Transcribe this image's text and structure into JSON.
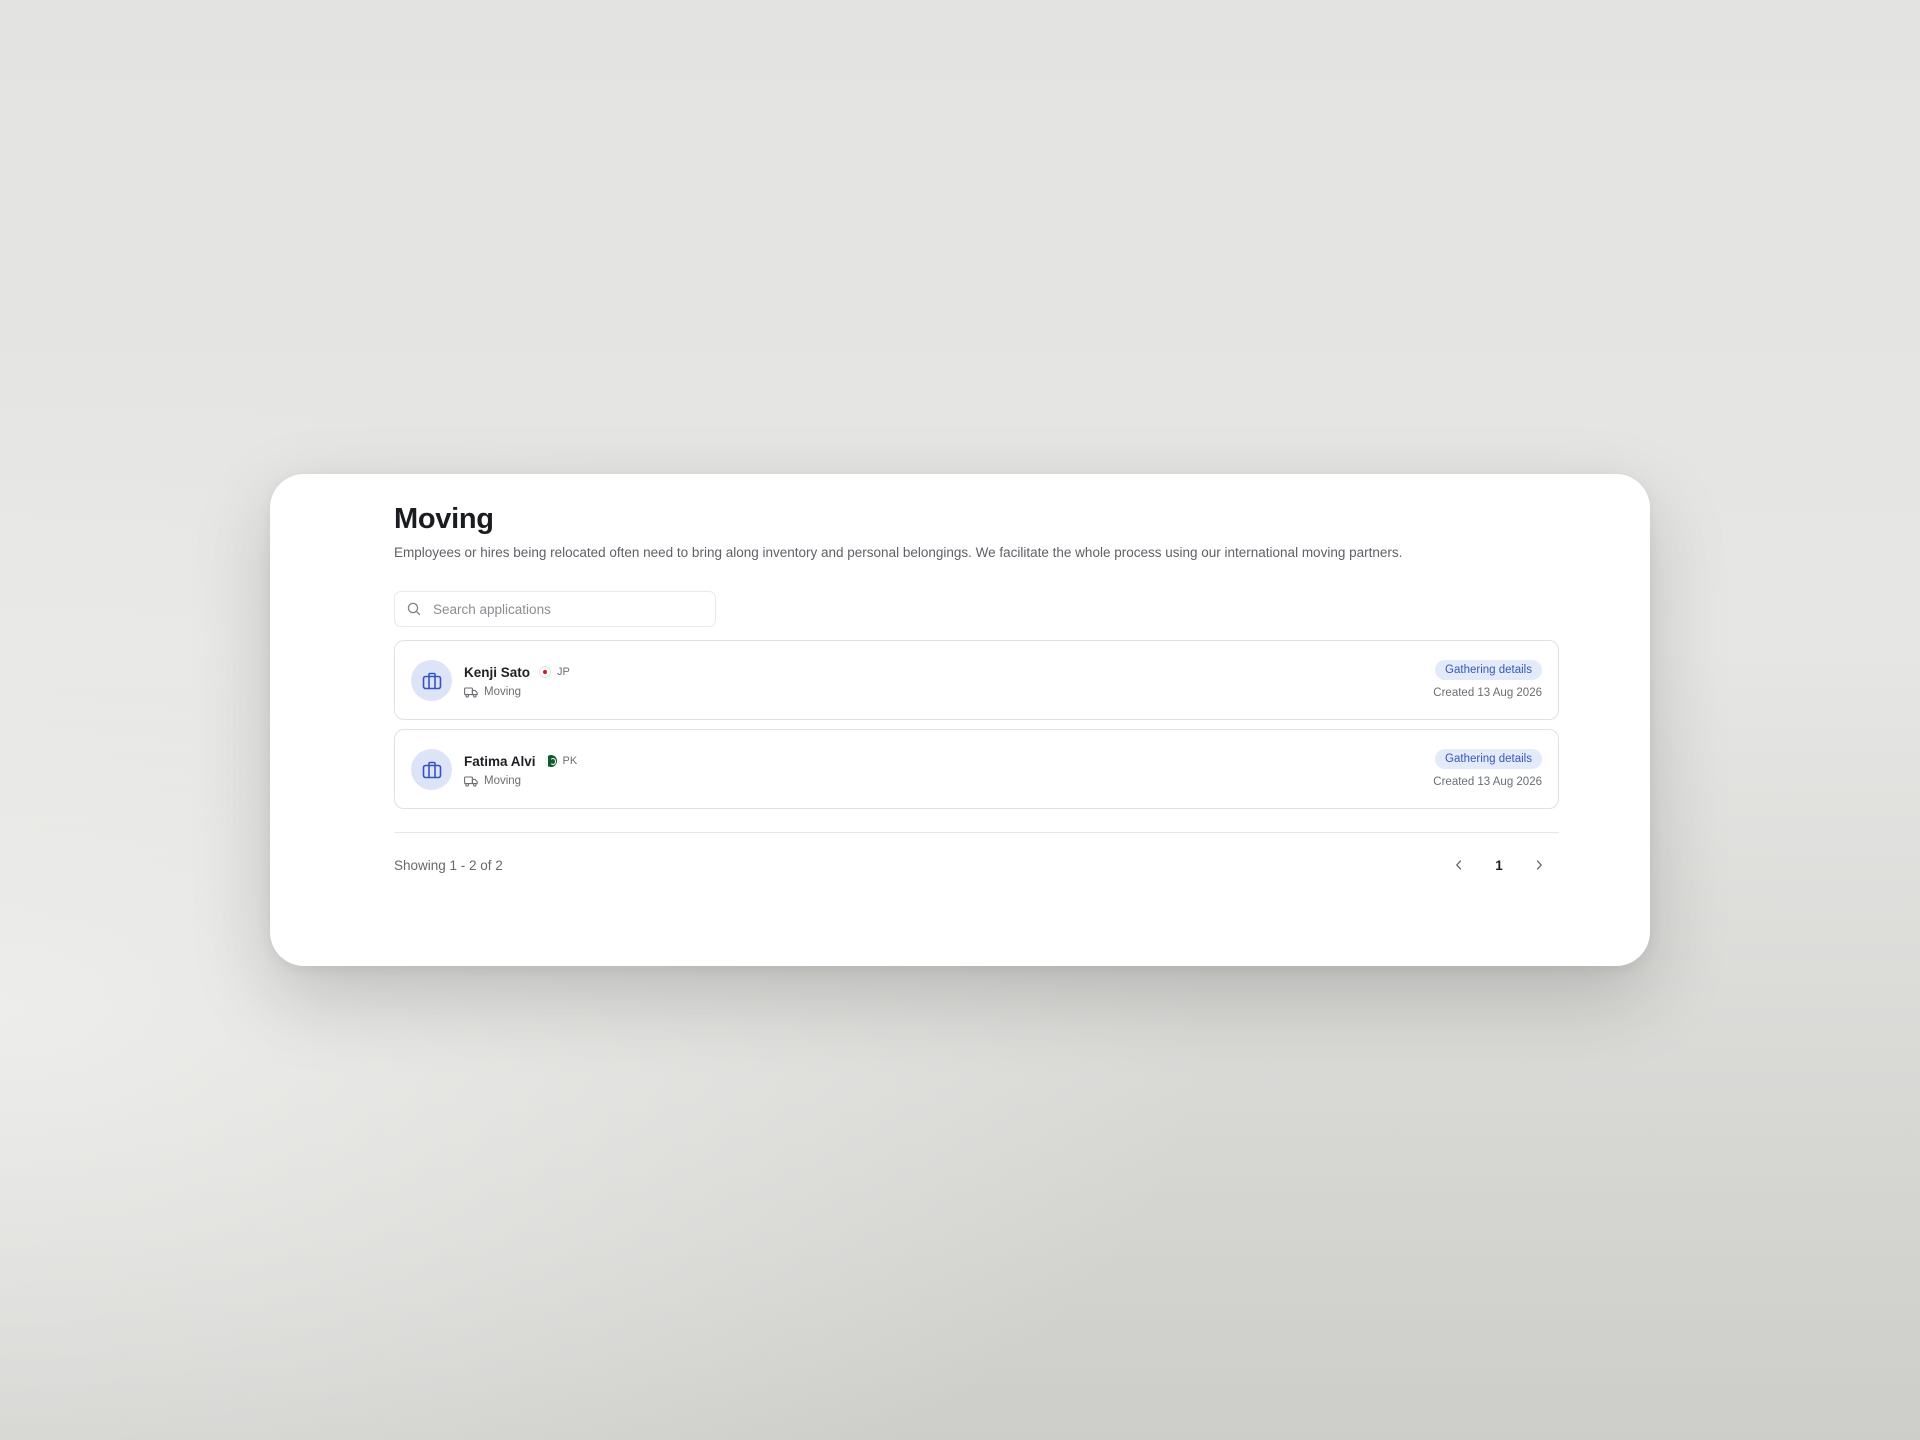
{
  "page": {
    "title": "Moving",
    "description": "Employees or hires being relocated often need to bring along inventory and personal belongings. We facilitate the whole process using our international moving partners."
  },
  "search": {
    "placeholder": "Search applications",
    "icon": "search-icon"
  },
  "applications": [
    {
      "name": "Kenji Sato",
      "country_code": "JP",
      "flag": "japan-flag",
      "type": "Moving",
      "type_icon": "truck-icon",
      "avatar_icon": "suitcase-icon",
      "status": "Gathering details",
      "created": "Created 13 Aug 2026"
    },
    {
      "name": "Fatima Alvi",
      "country_code": "PK",
      "flag": "pakistan-flag",
      "type": "Moving",
      "type_icon": "truck-icon",
      "avatar_icon": "suitcase-icon",
      "status": "Gathering details",
      "created": "Created 13 Aug 2026"
    }
  ],
  "pagination": {
    "showing": "Showing 1 - 2 of 2",
    "current_page": "1",
    "prev_icon": "chevron-left-icon",
    "next_icon": "chevron-right-icon"
  },
  "colors": {
    "accent": "#3558b8",
    "badge_bg": "#e3eaf9",
    "avatar_bg": "#dde4f7"
  }
}
